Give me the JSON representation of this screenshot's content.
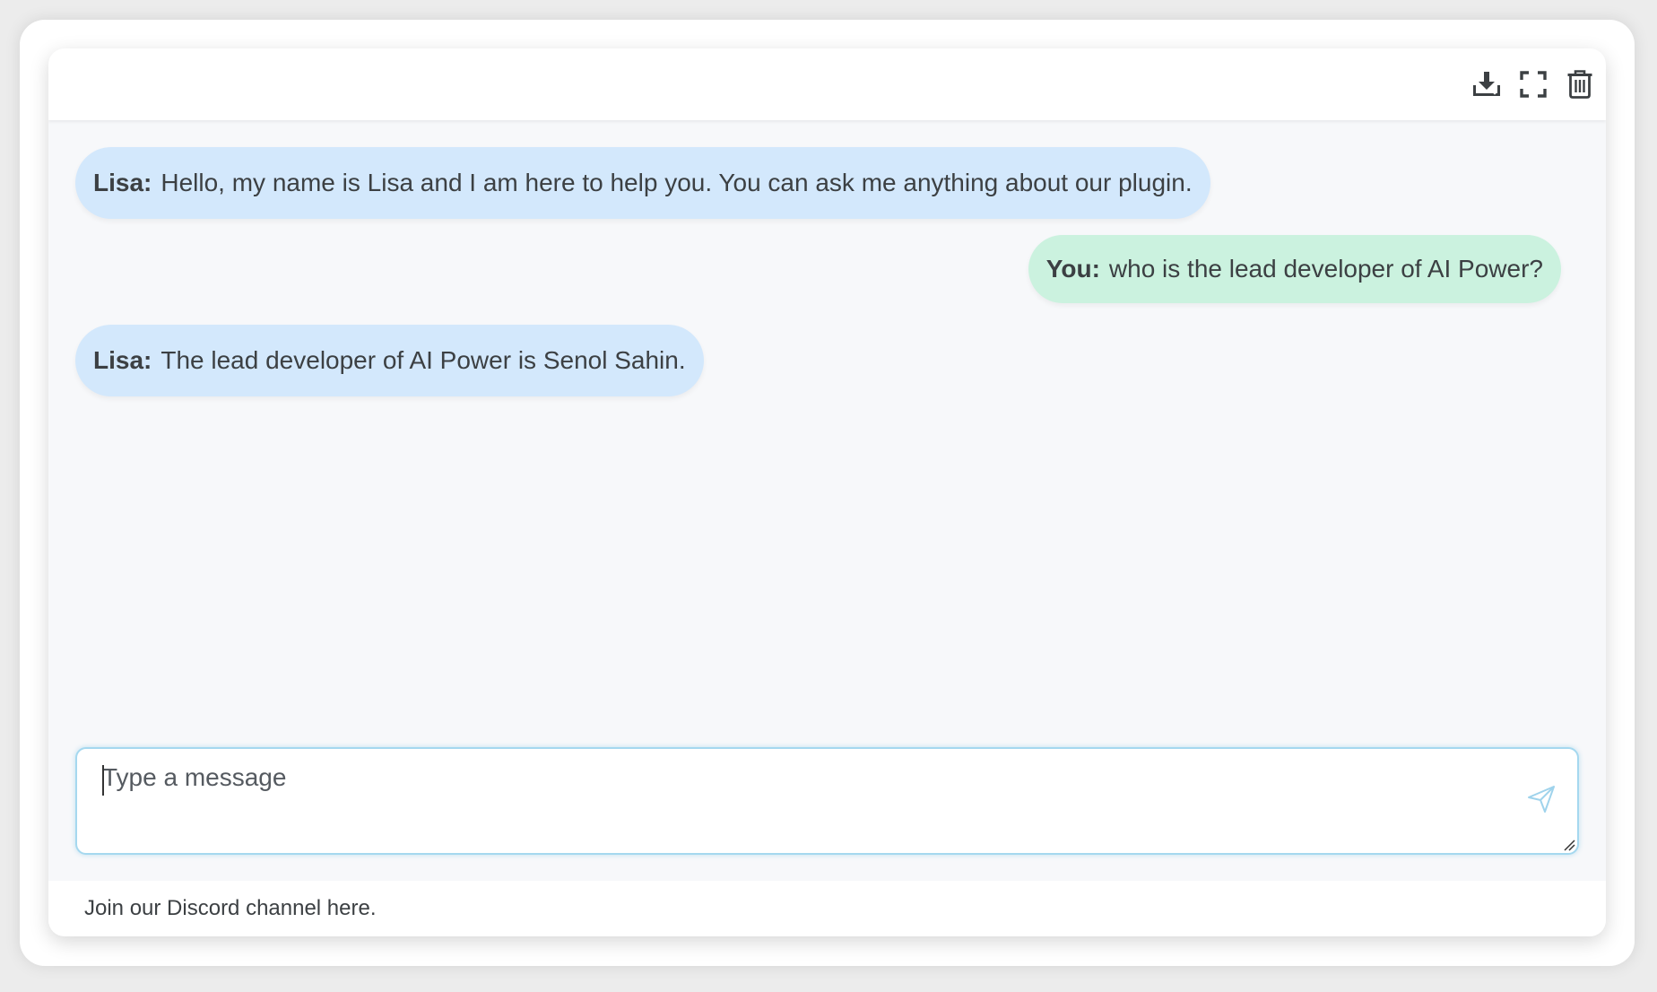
{
  "header": {
    "buttons": [
      {
        "name": "download-icon",
        "title": "Download"
      },
      {
        "name": "fullscreen-icon",
        "title": "Fullscreen"
      },
      {
        "name": "trash-icon",
        "title": "Clear chat"
      }
    ]
  },
  "messages": [
    {
      "role": "ai",
      "speaker": "Lisa:",
      "text": "Hello, my name is Lisa and I am here to help you. You can ask me anything about our plugin."
    },
    {
      "role": "user",
      "speaker": "You:",
      "text": "who is the lead developer of AI Power?"
    },
    {
      "role": "ai",
      "speaker": "Lisa:",
      "text": "The lead developer of AI Power is Senol Sahin."
    }
  ],
  "input": {
    "placeholder": "Type a message",
    "value": ""
  },
  "footer": {
    "text": "Join our Discord channel here."
  },
  "colors": {
    "ai_bubble": "#d3e8fc",
    "user_bubble": "#cbf2df",
    "input_border": "#a5d8ef",
    "send_icon": "#9fd3ec",
    "icon": "#3c4043"
  }
}
